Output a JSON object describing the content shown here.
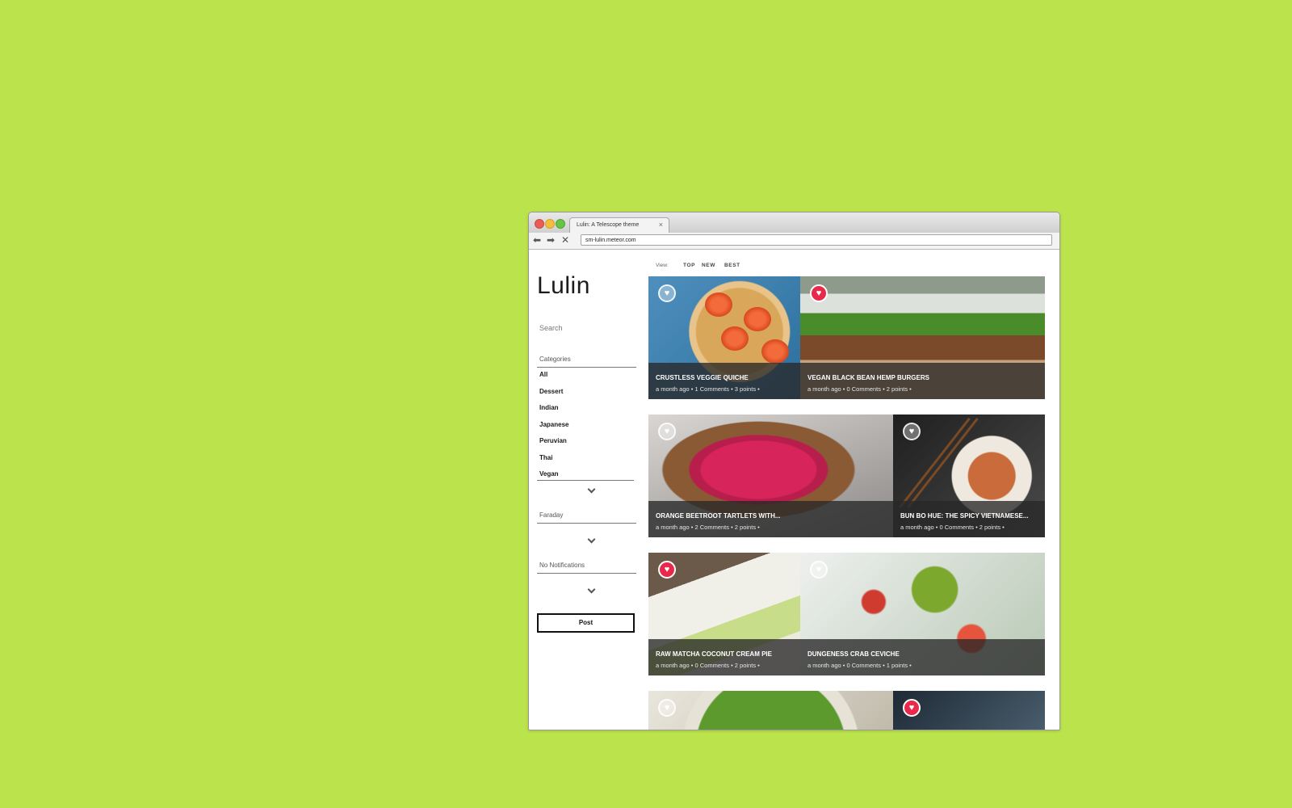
{
  "browser": {
    "tab_title": "Lulin: A Telescope theme",
    "tab_close": "×",
    "address": "sm-lulin.meteor.com",
    "nav_back": "⬅",
    "nav_forward": "➡",
    "nav_stop": "✕"
  },
  "sidebar": {
    "logo": "Lulin",
    "search_placeholder": "Search",
    "categories_label": "Categories",
    "categories": [
      "All",
      "Dessert",
      "Indian",
      "Japanese",
      "Peruvian",
      "Thai",
      "Vegan"
    ],
    "user_label": "Faraday",
    "notifications_label": "No Notifications",
    "post_button": "Post"
  },
  "view": {
    "label": "View:",
    "options": [
      "TOP",
      "NEW",
      "BEST"
    ]
  },
  "posts": [
    {
      "title": "CRUSTLESS VEGGIE QUICHE",
      "meta": "a month ago • 1 Comments • 3 points •",
      "liked": false
    },
    {
      "title": "VEGAN BLACK BEAN HEMP BURGERS",
      "meta": "a month ago • 0 Comments • 2 points •",
      "liked": true
    },
    {
      "title": "ORANGE BEETROOT TARTLETS WITH...",
      "meta": "a month ago • 2 Comments • 2 points •",
      "liked": false
    },
    {
      "title": "BUN BO HUE: THE SPICY VIETNAMESE...",
      "meta": "a month ago • 0 Comments • 2 points •",
      "liked": false
    },
    {
      "title": "RAW MATCHA COCONUT CREAM PIE",
      "meta": "a month ago • 0 Comments • 2 points •",
      "liked": true
    },
    {
      "title": "DUNGENESS CRAB CEVICHE",
      "meta": "a month ago • 0 Comments • 1 points •",
      "liked": false
    }
  ],
  "colors": {
    "background": "#bbe34c",
    "liked_heart": "#e8294b"
  },
  "icons": {
    "heart": "♥"
  }
}
